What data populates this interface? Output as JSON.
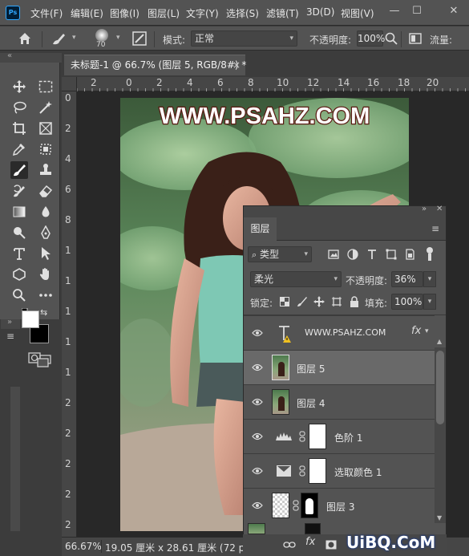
{
  "menubar": {
    "items": [
      "文件(F)",
      "编辑(E)",
      "图像(I)",
      "图层(L)",
      "文字(Y)",
      "选择(S)",
      "滤镜(T)",
      "3D(D)",
      "视图(V)"
    ]
  },
  "options": {
    "brush_size": "70",
    "mode_label": "模式:",
    "mode_value": "正常",
    "opacity_label": "不透明度:",
    "opacity_value": "100%",
    "flow_label": "流量:"
  },
  "document": {
    "tab_title": "未标题-1 @ 66.7% (图层 5, RGB/8#) *",
    "close": "×"
  },
  "ruler": {
    "h_ticks": [
      "2",
      "0",
      "2",
      "4",
      "6",
      "8",
      "10",
      "12",
      "14",
      "16",
      "18",
      "20"
    ],
    "v_ticks": [
      "0",
      "2",
      "4",
      "6",
      "8",
      "1",
      "1",
      "1",
      "1",
      "1",
      "2",
      "2",
      "2",
      "2",
      "2"
    ]
  },
  "photo": {
    "watermark_text": "WWW.PSAHZ.COM"
  },
  "status": {
    "zoom": "66.67%",
    "doc_size": "19.05 厘米 x 28.61 厘米 (72 ppi)"
  },
  "layers_panel": {
    "tab_label": "图层",
    "filter_kind": "类型",
    "blend_mode": "柔光",
    "opacity_label": "不透明度:",
    "opacity_value": "36%",
    "lock_label": "锁定:",
    "fill_label": "填充:",
    "fill_value": "100%",
    "layers": [
      {
        "name": "WWW.PSAHZ.COM",
        "kind": "text"
      },
      {
        "name": "图层 5",
        "kind": "pixel",
        "selected": true
      },
      {
        "name": "图层 4",
        "kind": "pixel"
      },
      {
        "name": "色阶 1",
        "kind": "adjustment-levels"
      },
      {
        "name": "选取颜色 1",
        "kind": "adjustment-selective-color"
      },
      {
        "name": "图层 3",
        "kind": "masked"
      }
    ],
    "footer": {
      "fx": "fx"
    }
  },
  "site_watermark": "UiBQ.CoM",
  "colors": {
    "accent": "#31a8ff",
    "panel": "#535353",
    "canvas_bg": "#282828",
    "selected_row": "#696969"
  }
}
